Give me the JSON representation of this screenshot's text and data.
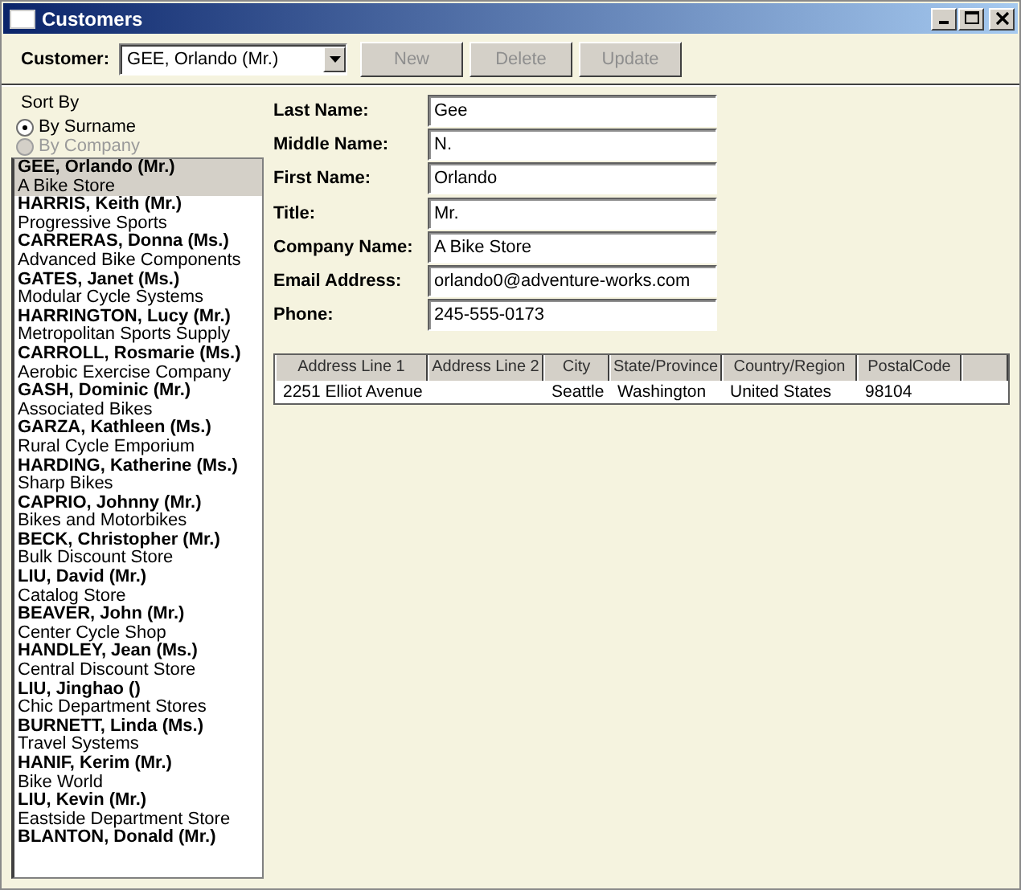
{
  "window": {
    "title": "Customers"
  },
  "toolbar": {
    "customer_label": "Customer:",
    "customer_value": "GEE, Orlando (Mr.)",
    "buttons": [
      {
        "label": "New",
        "disabled": true
      },
      {
        "label": "Delete",
        "disabled": true
      },
      {
        "label": "Update",
        "disabled": true
      }
    ]
  },
  "sort_by": {
    "label": "Sort By",
    "options": [
      {
        "label": "By Surname",
        "selected": true,
        "disabled": false
      },
      {
        "label": "By Company",
        "selected": false,
        "disabled": true
      }
    ]
  },
  "customers": [
    {
      "name": "GEE, Orlando (Mr.)",
      "company": "A Bike Store",
      "selected": true
    },
    {
      "name": "HARRIS, Keith (Mr.)",
      "company": "Progressive Sports",
      "selected": false
    },
    {
      "name": "CARRERAS, Donna (Ms.)",
      "company": "Advanced Bike Components",
      "selected": false
    },
    {
      "name": "GATES, Janet (Ms.)",
      "company": "Modular Cycle Systems",
      "selected": false
    },
    {
      "name": "HARRINGTON, Lucy (Mr.)",
      "company": "Metropolitan Sports Supply",
      "selected": false
    },
    {
      "name": "CARROLL, Rosmarie (Ms.)",
      "company": "Aerobic Exercise Company",
      "selected": false
    },
    {
      "name": "GASH, Dominic (Mr.)",
      "company": "Associated Bikes",
      "selected": false
    },
    {
      "name": "GARZA, Kathleen (Ms.)",
      "company": "Rural Cycle Emporium",
      "selected": false
    },
    {
      "name": "HARDING, Katherine (Ms.)",
      "company": "Sharp Bikes",
      "selected": false
    },
    {
      "name": "CAPRIO, Johnny (Mr.)",
      "company": "Bikes and Motorbikes",
      "selected": false
    },
    {
      "name": "BECK, Christopher (Mr.)",
      "company": "Bulk Discount Store",
      "selected": false
    },
    {
      "name": "LIU, David (Mr.)",
      "company": "Catalog Store",
      "selected": false
    },
    {
      "name": "BEAVER, John (Mr.)",
      "company": "Center Cycle Shop",
      "selected": false
    },
    {
      "name": "HANDLEY, Jean (Ms.)",
      "company": "Central Discount Store",
      "selected": false
    },
    {
      "name": "LIU, Jinghao ()",
      "company": "Chic Department Stores",
      "selected": false
    },
    {
      "name": "BURNETT, Linda (Ms.)",
      "company": "Travel Systems",
      "selected": false
    },
    {
      "name": "HANIF, Kerim (Mr.)",
      "company": "Bike World",
      "selected": false
    },
    {
      "name": "LIU, Kevin (Mr.)",
      "company": "Eastside Department Store",
      "selected": false
    },
    {
      "name": "BLANTON, Donald (Mr.)",
      "selected": false
    }
  ],
  "fields": [
    {
      "label": "Last Name:",
      "value": "Gee"
    },
    {
      "label": "Middle Name:",
      "value": "N."
    },
    {
      "label": "First Name:",
      "value": "Orlando"
    },
    {
      "label": "Title:",
      "value": "Mr."
    },
    {
      "label": "Company Name:",
      "value": "A Bike Store"
    },
    {
      "label": "Email Address:",
      "value": "orlando0@adventure-works.com"
    },
    {
      "label": "Phone:",
      "value": "245-555-0173"
    }
  ],
  "address_table": {
    "columns": [
      "Address Line 1",
      "Address Line 2",
      "City",
      "State/Province",
      "Country/Region",
      "PostalCode"
    ],
    "rows": [
      [
        "2251 Elliot Avenue",
        "",
        "Seattle",
        "Washington",
        "United States",
        "98104"
      ]
    ]
  }
}
